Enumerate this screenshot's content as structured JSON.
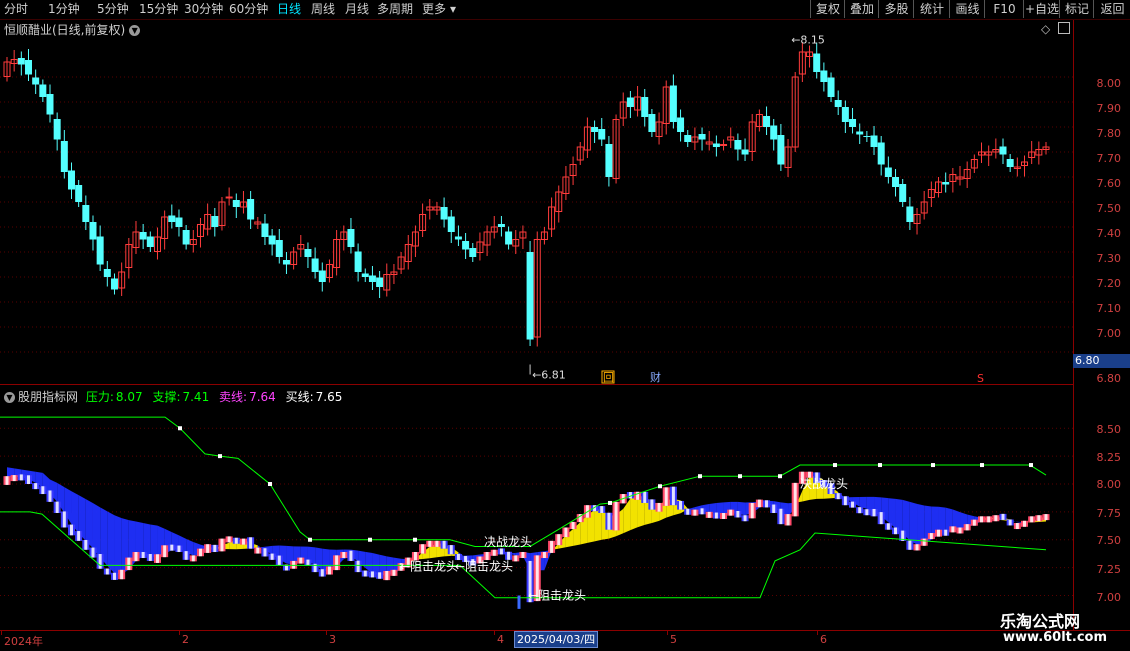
{
  "toolbar": {
    "left": [
      "分时",
      "1分钟",
      "5分钟",
      "15分钟",
      "30分钟",
      "60分钟",
      "日线",
      "周线",
      "月线",
      "多周期",
      "更多"
    ],
    "active": "日线",
    "right": [
      "复权",
      "叠加",
      "多股",
      "统计",
      "画线",
      "F10",
      "+自选",
      "标记",
      "返回"
    ]
  },
  "main": {
    "title": "恒顺醋业(日线,前复权)",
    "high_label": "8.15",
    "low_label": "6.81",
    "y_ticks": [
      "8.00",
      "7.90",
      "7.80",
      "7.70",
      "7.60",
      "7.50",
      "7.40",
      "7.30",
      "7.20",
      "7.10",
      "7.00",
      "6.90",
      "6.80"
    ],
    "price_tag": "6.80",
    "marker_hui": "回",
    "marker_cai": "财",
    "marker_s": "S"
  },
  "indicator": {
    "name": "股朋指标网",
    "pressure_label": "压力:",
    "pressure_value": "8.07",
    "support_label": "支撑:",
    "support_value": "7.41",
    "sell_label": "卖线:",
    "sell_value": "7.64",
    "buy_label": "买线:",
    "buy_value": "7.65",
    "y_ticks": [
      "8.50",
      "8.25",
      "8.00",
      "7.75",
      "7.50",
      "7.25",
      "7.00"
    ],
    "annotations": [
      "←阻击龙头",
      "←阻击龙头",
      "←阻击龙头",
      "决战龙头",
      "决战龙头"
    ]
  },
  "x_axis": {
    "labels": [
      "2024年",
      "2",
      "3",
      "4",
      "5",
      "6"
    ],
    "cursor_date": "2025/04/03/四"
  },
  "watermark": {
    "line1": "乐淘公式网",
    "line2": "www.60lt.com"
  },
  "colors": {
    "up": "#ff3c3c",
    "down": "#54ffff",
    "axis": "#8b0000",
    "pressure": "#00ff00",
    "support": "#00ff00",
    "fill_blue": "#2030ff",
    "fill_yellow": "#ffee00"
  },
  "chart_data": {
    "type": "candlestick",
    "series": [
      {
        "name": "price",
        "values": [
          8.06,
          8.07,
          8.05,
          8.01,
          7.97,
          7.92,
          7.85,
          7.75,
          7.62,
          7.55,
          7.5,
          7.42,
          7.35,
          7.25,
          7.2,
          7.15,
          7.22,
          7.33,
          7.38,
          7.35,
          7.32,
          7.36,
          7.44,
          7.42,
          7.4,
          7.33,
          7.35,
          7.41,
          7.45,
          7.4,
          7.5,
          7.52,
          7.48,
          7.5,
          7.43,
          7.42,
          7.36,
          7.33,
          7.28,
          7.25,
          7.3,
          7.33,
          7.28,
          7.22,
          7.18,
          7.25,
          7.35,
          7.38,
          7.32,
          7.22,
          7.2,
          7.18,
          7.16,
          7.21,
          7.22,
          7.28,
          7.33,
          7.38,
          7.45,
          7.48,
          7.48,
          7.43,
          7.38,
          7.35,
          7.31,
          7.28,
          7.34,
          7.38,
          7.4,
          7.4,
          7.33,
          7.35,
          7.38,
          6.95,
          7.35,
          7.38,
          7.48,
          7.54,
          7.6,
          7.65,
          7.72,
          7.8,
          7.78,
          7.75,
          7.6,
          7.83,
          7.9,
          7.88,
          7.92,
          7.84,
          7.78,
          7.82,
          7.96,
          7.82,
          7.78,
          7.74,
          7.76,
          7.75,
          7.74,
          7.72,
          7.73,
          7.76,
          7.71,
          7.69,
          7.82,
          7.85,
          7.8,
          7.75,
          7.65,
          7.72,
          8.0,
          8.1,
          8.1,
          8.02,
          7.98,
          7.92,
          7.88,
          7.82,
          7.8,
          7.77,
          7.76,
          7.72,
          7.65,
          7.6,
          7.56,
          7.5,
          7.42,
          7.45,
          7.5,
          7.55,
          7.58,
          7.57,
          7.61,
          7.6,
          7.63,
          7.67,
          7.7,
          7.7,
          7.71,
          7.69,
          7.64,
          7.64,
          7.66,
          7.7,
          7.71,
          7.72
        ]
      }
    ]
  }
}
